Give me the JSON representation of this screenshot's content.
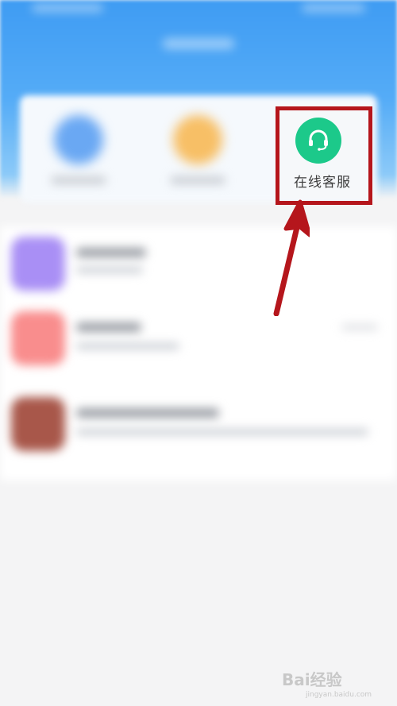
{
  "online_service": {
    "label": "在线客服",
    "icon": "headset-icon",
    "icon_color": "#1cc98a"
  },
  "highlight_color": "#b5161c",
  "watermark": {
    "brand": "Bai经验",
    "url": "jingyan.baidu.com"
  }
}
